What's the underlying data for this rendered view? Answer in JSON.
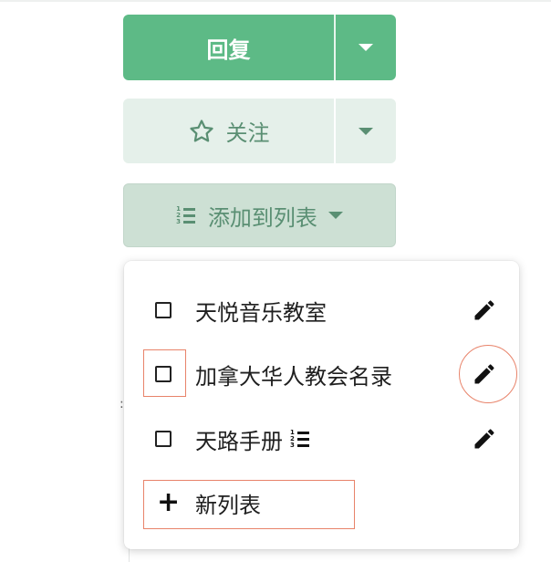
{
  "buttons": {
    "reply_label": "回复",
    "follow_label": "关注",
    "add_to_list_label": "添加到列表"
  },
  "list_icon": {
    "nums": [
      "1",
      "2",
      "3"
    ]
  },
  "dropdown": {
    "items": [
      {
        "label": "天悦音乐教室",
        "checked": false,
        "has_list_icon": false
      },
      {
        "label": "加拿大华人教会名录",
        "checked": false,
        "has_list_icon": false
      },
      {
        "label": "天路手册",
        "checked": false,
        "has_list_icon": true
      }
    ],
    "new_list_label": "新列表"
  },
  "colors": {
    "primary_green": "#5dba86",
    "light_green": "#e5f0ea",
    "muted_green": "#cde0d4",
    "green_text": "#5a8f73",
    "highlight": "#e8836a"
  },
  "icons": [
    "chevron-down-icon",
    "star-icon",
    "list-numbered-icon",
    "pencil-icon",
    "plus-icon"
  ]
}
